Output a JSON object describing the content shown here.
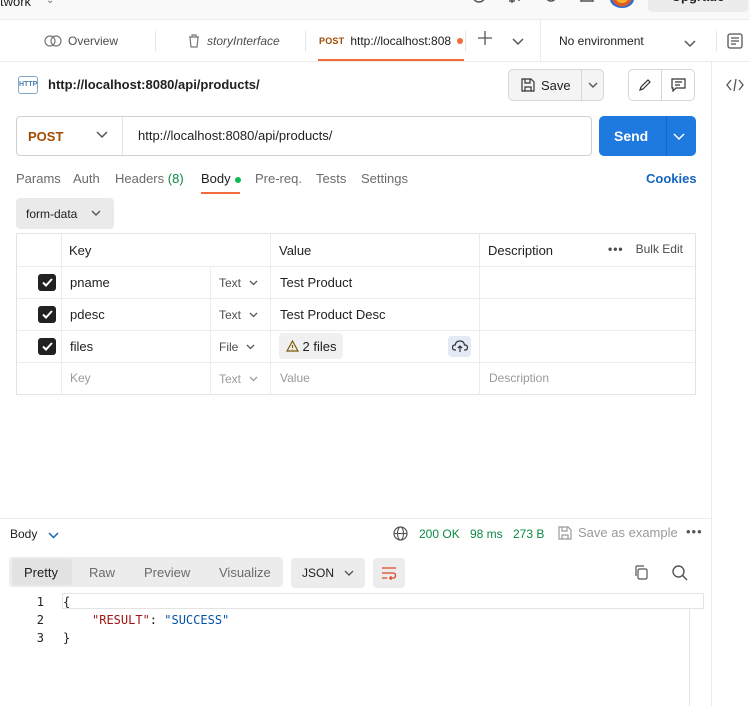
{
  "topbar": {
    "workspace": "twork",
    "upgrade_label": "Upgrade"
  },
  "tabs": [
    {
      "label": "Overview"
    },
    {
      "label": "storyInterface"
    },
    {
      "method": "POST",
      "label": "http://localhost:808"
    }
  ],
  "environment": {
    "label": "No environment"
  },
  "request": {
    "title": "http://localhost:8080/api/products/",
    "save_label": "Save",
    "method": "POST",
    "url": "http://localhost:8080/api/products/",
    "send_label": "Send"
  },
  "request_tabs": {
    "params": "Params",
    "auth": "Auth",
    "headers": "Headers",
    "headers_count": "(8)",
    "body": "Body",
    "prereq": "Pre-req.",
    "tests": "Tests",
    "settings": "Settings",
    "cookies": "Cookies"
  },
  "body_mode": "form-data",
  "table": {
    "headers": {
      "key": "Key",
      "value": "Value",
      "description": "Description",
      "bulk_edit": "Bulk Edit"
    },
    "rows": [
      {
        "key": "pname",
        "type": "Text",
        "value": "Test Product"
      },
      {
        "key": "pdesc",
        "type": "Text",
        "value": "Test Product Desc"
      },
      {
        "key": "files",
        "type": "File",
        "value": "2 files"
      }
    ],
    "placeholder": {
      "key": "Key",
      "type": "Text",
      "value": "Value",
      "description": "Description"
    }
  },
  "response": {
    "label": "Body",
    "status": "200 OK",
    "time": "98 ms",
    "size": "273 B",
    "save_example": "Save as example",
    "view_tabs": [
      "Pretty",
      "Raw",
      "Preview",
      "Visualize"
    ],
    "format": "JSON",
    "lines": [
      {
        "num": "1",
        "text": "{"
      },
      {
        "num": "2",
        "key": "\"RESULT\"",
        "colon": ": ",
        "val": "\"SUCCESS\""
      },
      {
        "num": "3",
        "text": "}"
      }
    ]
  },
  "colors": {
    "accent": "#f26b3a",
    "send": "#1f7ae0",
    "method": "#a14a00",
    "status_ok": "#0b8a43",
    "link": "#1565c0"
  }
}
